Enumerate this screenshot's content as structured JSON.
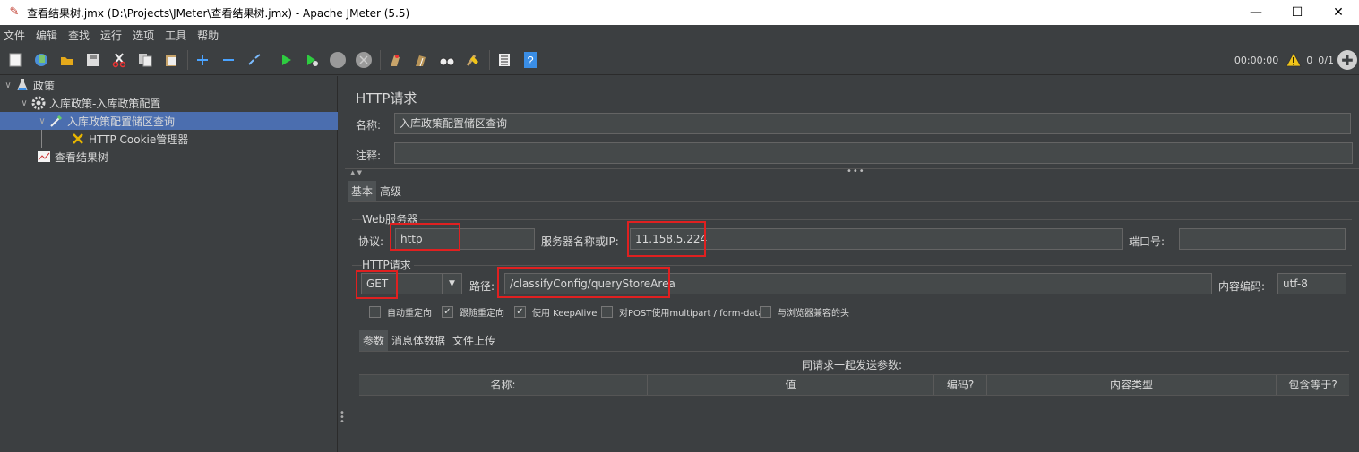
{
  "window": {
    "title": "查看结果树.jmx (D:\\Projects\\JMeter\\查看结果树.jmx) - Apache JMeter (5.5)",
    "minimize": "—",
    "maximize": "☐",
    "close": "✕"
  },
  "menu": [
    "文件",
    "编辑",
    "查找",
    "运行",
    "选项",
    "工具",
    "帮助"
  ],
  "toolbar": {
    "icons": [
      "new-icon",
      "templates-icon",
      "open-icon",
      "save-icon",
      "cut-icon",
      "copy-icon",
      "paste-icon",
      "expand-icon",
      "collapse-icon",
      "toggle-icon",
      "start-icon",
      "start-no-pause-icon",
      "stop-icon",
      "shutdown-icon",
      "clear-icon",
      "clear-all-icon",
      "search-icon",
      "reset-search-icon",
      "function-helper-icon",
      "help-icon"
    ],
    "timer": "00:00:00",
    "warning_count": "0",
    "threads": "0/1"
  },
  "tree": {
    "items": [
      {
        "label": "政策",
        "icon": "test-plan-icon"
      },
      {
        "label": "入库政策-入库政策配置",
        "icon": "thread-group-icon"
      },
      {
        "label": "入库政策配置储区查询",
        "icon": "http-sampler-icon"
      },
      {
        "label": "HTTP Cookie管理器",
        "icon": "cookie-manager-icon"
      },
      {
        "label": "查看结果树",
        "icon": "results-tree-icon"
      }
    ]
  },
  "form": {
    "title": "HTTP请求",
    "name_label": "名称:",
    "name_value": "入库政策配置储区查询",
    "comment_label": "注释:",
    "comment_value": "",
    "tabs": [
      "基本",
      "高级"
    ],
    "web_server_group": "Web服务器",
    "protocol_label": "协议:",
    "protocol_value": "http",
    "server_label": "服务器名称或IP:",
    "server_value": "11.158.5.224",
    "port_label": "端口号:",
    "port_value": "",
    "http_request_group": "HTTP请求",
    "method_value": "GET",
    "path_label": "路径:",
    "path_value": "/classifyConfig/queryStoreArea",
    "encoding_label": "内容编码:",
    "encoding_value": "utf-8",
    "checkboxes": [
      {
        "label": "自动重定向",
        "checked": false
      },
      {
        "label": "跟随重定向",
        "checked": true
      },
      {
        "label": "使用 KeepAlive",
        "checked": true
      },
      {
        "label": "对POST使用multipart / form-data",
        "checked": false
      },
      {
        "label": "与浏览器兼容的头",
        "checked": false
      }
    ],
    "sub_tabs": [
      "参数",
      "消息体数据",
      "文件上传"
    ],
    "params_caption": "同请求一起发送参数:",
    "columns": [
      "名称:",
      "值",
      "编码?",
      "内容类型",
      "包含等于?"
    ]
  }
}
